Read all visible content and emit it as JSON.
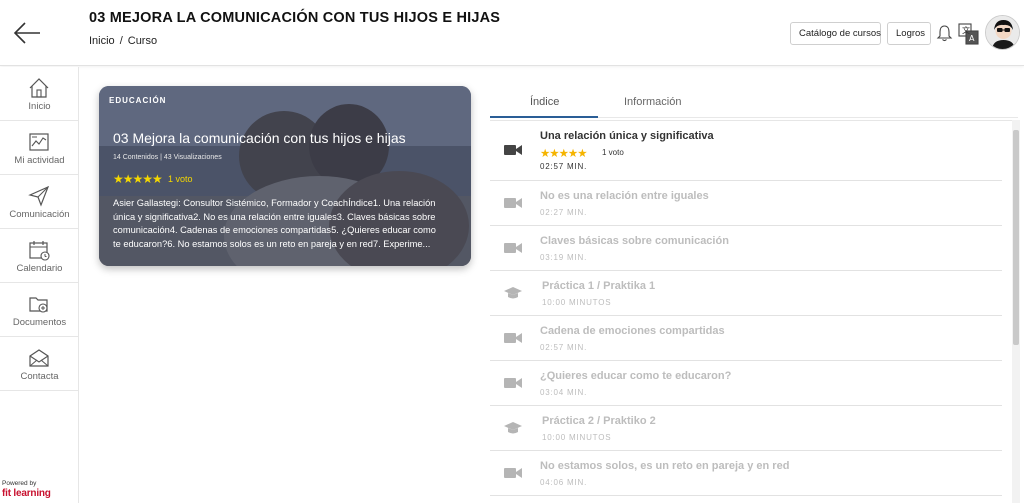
{
  "header": {
    "title": "03 MEJORA LA COMUNICACIÓN CON TUS HIJOS E HIJAS",
    "breadcrumb": [
      "Inicio",
      "Curso"
    ],
    "breadcrumb_sep": "/",
    "catalog_button": "Catálogo de cursos",
    "achievements_button": "Logros",
    "icons": [
      "back-arrow-icon",
      "bell-icon",
      "translate-icon",
      "avatar"
    ]
  },
  "sidebar": {
    "items": [
      {
        "label": "Inicio",
        "icon": "home-icon"
      },
      {
        "label": "Mi actividad",
        "icon": "activity-icon"
      },
      {
        "label": "Comunicación",
        "icon": "send-icon"
      },
      {
        "label": "Calendario",
        "icon": "calendar-icon"
      },
      {
        "label": "Documentos",
        "icon": "folder-icon"
      },
      {
        "label": "Contacta",
        "icon": "mail-icon"
      }
    ],
    "powered_by": "Powered by",
    "brand": "fit learning"
  },
  "course_card": {
    "category": "EDUCACIÓN",
    "title": "03 Mejora la comunicación con tus hijos e hijas",
    "meta": "14 Contenidos | 43 Visualizaciones",
    "stars": "★★★★★",
    "rating": 5,
    "votes": "1 voto",
    "description": "Asier Gallastegi: Consultor Sistémico, Formador y CoachÍndice1. Una relación única y significativa2. No es una relación entre iguales3. Claves básicas sobre comunicación4. Cadenas de emociones compartidas5. ¿Quieres educar como te educaron?6. No estamos solos es un reto en pareja y en red7. Experime..."
  },
  "tabs": [
    {
      "label": "Índice",
      "active": true
    },
    {
      "label": "Información",
      "active": false
    }
  ],
  "lessons": [
    {
      "title": "Una relación única y significativa",
      "duration": "02:57 MIN.",
      "type": "video",
      "stars": "★★★★★",
      "votes": "1 voto",
      "active": true
    },
    {
      "title": "No es una relación entre iguales",
      "duration": "02:27 MIN.",
      "type": "video"
    },
    {
      "title": "Claves básicas sobre comunicación",
      "duration": "03:19 MIN.",
      "type": "video"
    },
    {
      "title": "Práctica 1 / Praktika 1",
      "duration": "10:00 MINUTOS",
      "type": "practice"
    },
    {
      "title": "Cadena de emociones compartidas",
      "duration": "02:57 MIN.",
      "type": "video"
    },
    {
      "title": "¿Quieres educar como te educaron?",
      "duration": "03:04 MIN.",
      "type": "video"
    },
    {
      "title": "Práctica 2 / Praktiko 2",
      "duration": "10:00 MINUTOS",
      "type": "practice"
    },
    {
      "title": "No estamos solos, es un reto en pareja y en red",
      "duration": "04:06 MIN.",
      "type": "video"
    }
  ],
  "colors": {
    "accent": "#2a5e96",
    "star_card": "#f5d800",
    "star_list": "#f5b400",
    "muted_text": "#bdbdbd",
    "brand_red": "#c8102e"
  }
}
